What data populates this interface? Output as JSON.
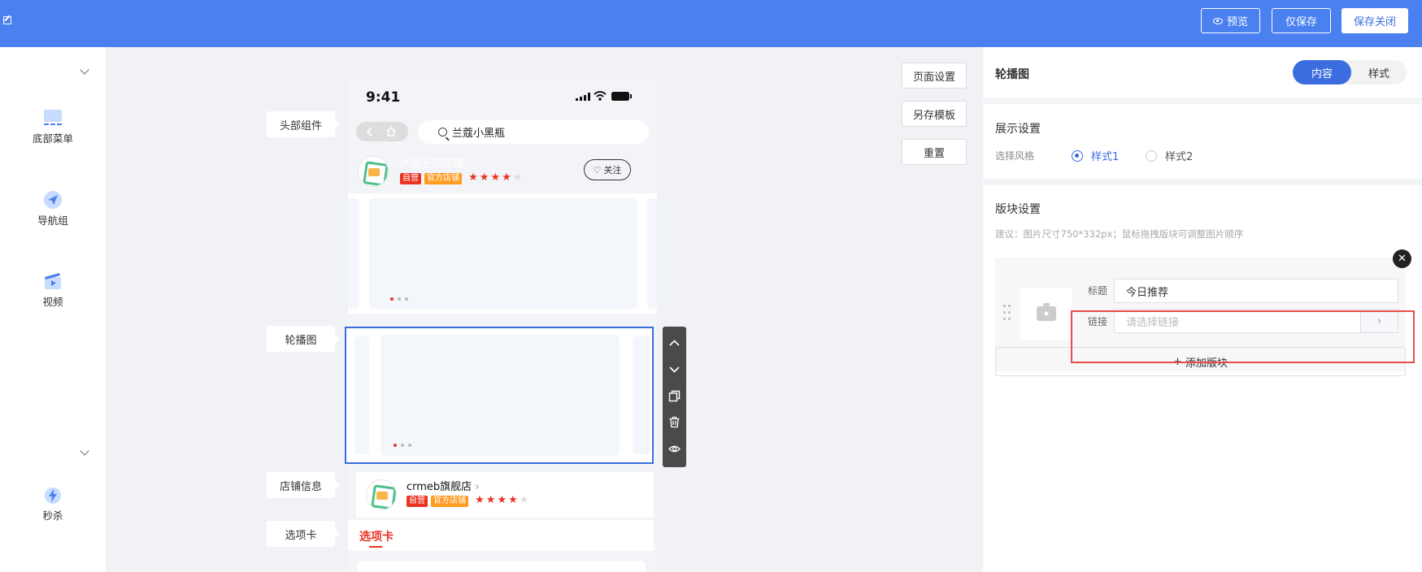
{
  "topbar": {
    "preview_label": "预览",
    "save_only_label": "仅保存",
    "save_close_label": "保存关闭"
  },
  "sidebar": {
    "items": [
      {
        "label": "底部菜单",
        "icon": "bottom-menu-icon"
      },
      {
        "label": "导航组",
        "icon": "navigation-icon"
      },
      {
        "label": "视频",
        "icon": "video-icon"
      },
      {
        "label": "秒杀",
        "icon": "flash-sale-icon"
      }
    ]
  },
  "canvas": {
    "labels": [
      "头部组件",
      "轮播图",
      "店铺信息",
      "选项卡"
    ],
    "buttons": [
      "页面设置",
      "另存模板",
      "重置"
    ]
  },
  "phone": {
    "time": "9:41",
    "search_text": "兰蔻小黑瓶",
    "store1_name": "大猴子的店铺",
    "store2_name": "crmeb旗舰店",
    "badge_self": "自营",
    "badge_official": "官方店铺",
    "follow_label": "关注",
    "tab_label": "选项卡",
    "store1_rating": 4,
    "store2_rating": 4,
    "rating_max": 5
  },
  "panel": {
    "title": "轮播图",
    "tab_content": "内容",
    "tab_style": "样式",
    "display_section": "展示设置",
    "style_label": "选择风格",
    "style_option1": "样式1",
    "style_option2": "样式2",
    "block_section": "版块设置",
    "hint": "建议：图片尺寸750*332px；鼠标拖拽版块可调整图片顺序",
    "title_label": "标题",
    "title_value": "今日推荐",
    "link_label": "链接",
    "link_placeholder": "请选择链接",
    "add_block_label": "添加版块"
  },
  "colors": {
    "topbar": "#4a80f0",
    "accent": "#3b6de0",
    "highlight": "#e84c4c",
    "brand_red": "#e93323"
  }
}
